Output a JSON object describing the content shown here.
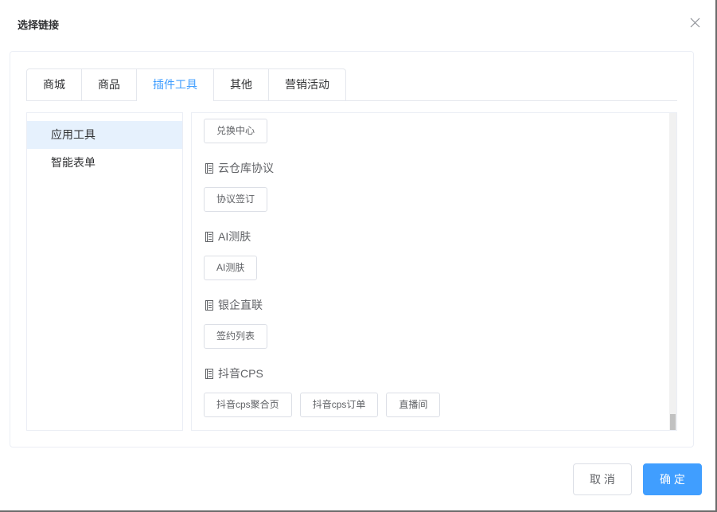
{
  "dialog": {
    "title": "选择链接",
    "close_icon": "close-icon"
  },
  "tabs": [
    {
      "label": "商城",
      "active": false
    },
    {
      "label": "商品",
      "active": false
    },
    {
      "label": "插件工具",
      "active": true
    },
    {
      "label": "其他",
      "active": false
    },
    {
      "label": "营销活动",
      "active": false
    }
  ],
  "sidebar": {
    "items": [
      {
        "label": "应用工具",
        "selected": true
      },
      {
        "label": "智能表单",
        "selected": false
      }
    ]
  },
  "content": {
    "top_buttons": [
      {
        "label": "兑换中心"
      }
    ],
    "section_icon": "document-icon",
    "sections": [
      {
        "title": "云仓库协议",
        "buttons": [
          {
            "label": "协议签订"
          }
        ]
      },
      {
        "title": "AI测肤",
        "buttons": [
          {
            "label": "AI测肤"
          }
        ]
      },
      {
        "title": "银企直联",
        "buttons": [
          {
            "label": "签约列表"
          }
        ]
      },
      {
        "title": "抖音CPS",
        "buttons": [
          {
            "label": "抖音cps聚合页"
          },
          {
            "label": "抖音cps订单"
          },
          {
            "label": "直播间"
          }
        ]
      }
    ],
    "scroll_fraction": 1
  },
  "footer": {
    "cancel_label": "取 消",
    "confirm_label": "确 定"
  },
  "colors": {
    "accent": "#409eff",
    "selected_bg": "#e6f1fd"
  }
}
